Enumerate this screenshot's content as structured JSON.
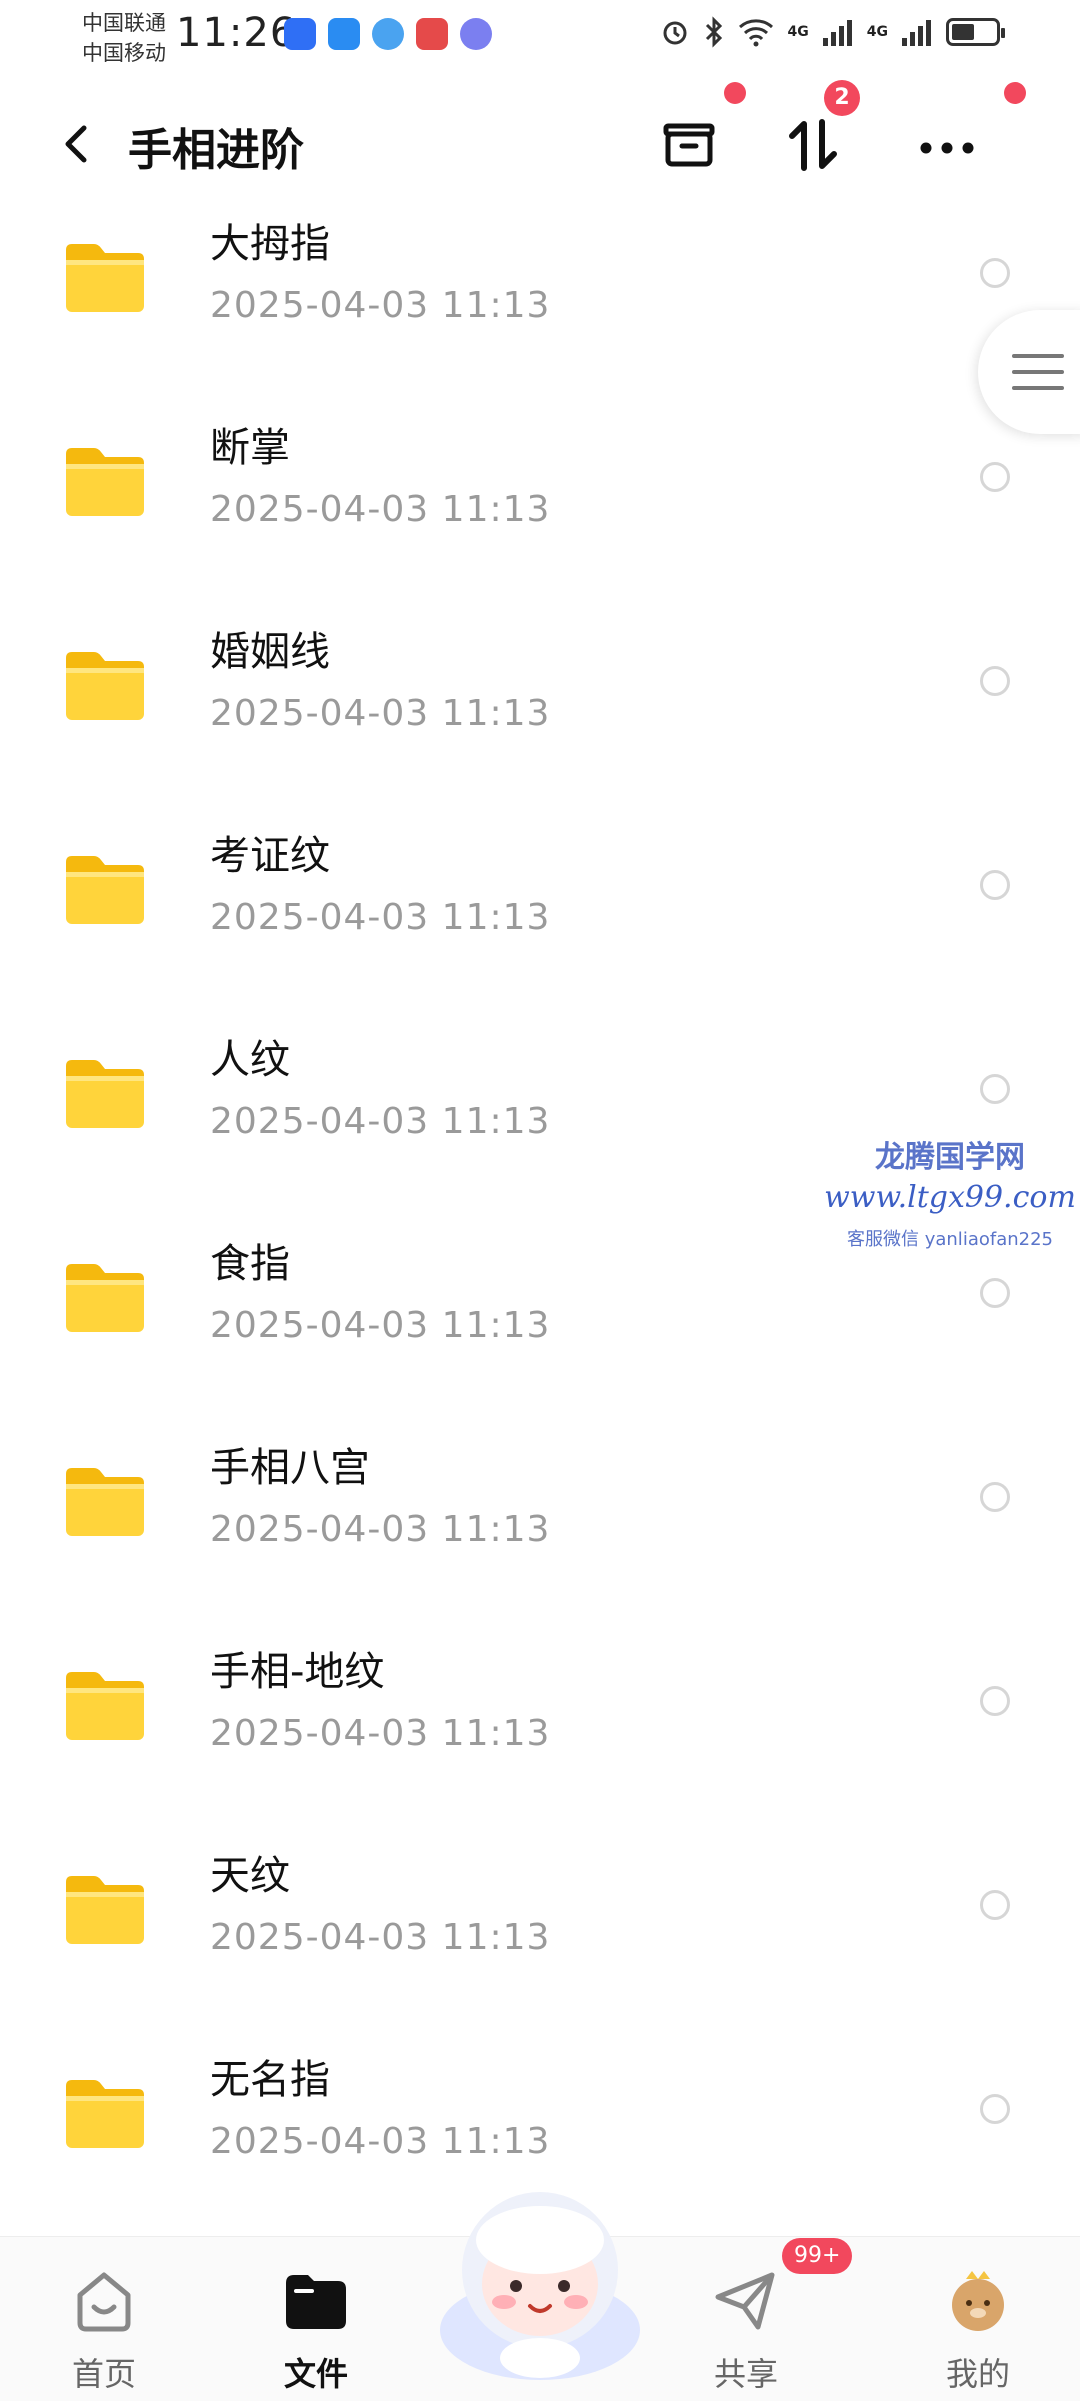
{
  "status_bar": {
    "carrier_1": "中国联通",
    "carrier_2": "中国移动",
    "time": "11:26",
    "signal_1": "4G",
    "signal_2": "4G"
  },
  "header": {
    "title": "手相进阶",
    "transfer_badge": "2"
  },
  "files": [
    {
      "name": "大拇指",
      "date": "2025-04-03  11:13"
    },
    {
      "name": "断掌",
      "date": "2025-04-03  11:13"
    },
    {
      "name": "婚姻线",
      "date": "2025-04-03  11:13"
    },
    {
      "name": "考证纹",
      "date": "2025-04-03  11:13"
    },
    {
      "name": "人纹",
      "date": "2025-04-03  11:13"
    },
    {
      "name": "食指",
      "date": "2025-04-03  11:13"
    },
    {
      "name": "手相八宫",
      "date": "2025-04-03  11:13"
    },
    {
      "name": "手相-地纹",
      "date": "2025-04-03  11:13"
    },
    {
      "name": "天纹",
      "date": "2025-04-03  11:13"
    },
    {
      "name": "无名指",
      "date": "2025-04-03  11:13"
    }
  ],
  "watermark": {
    "line1": "龙腾国学网",
    "line2": "www.ltgx99.com",
    "line3": "客服微信 yanliaofan225"
  },
  "bottom_nav": {
    "home": "首页",
    "files": "文件",
    "share": "共享",
    "share_badge": "99+",
    "mine": "我的"
  },
  "colors": {
    "accent_red": "#f2485d",
    "folder_yellow": "#ffd43b",
    "date_gray": "#9a9a9a"
  }
}
